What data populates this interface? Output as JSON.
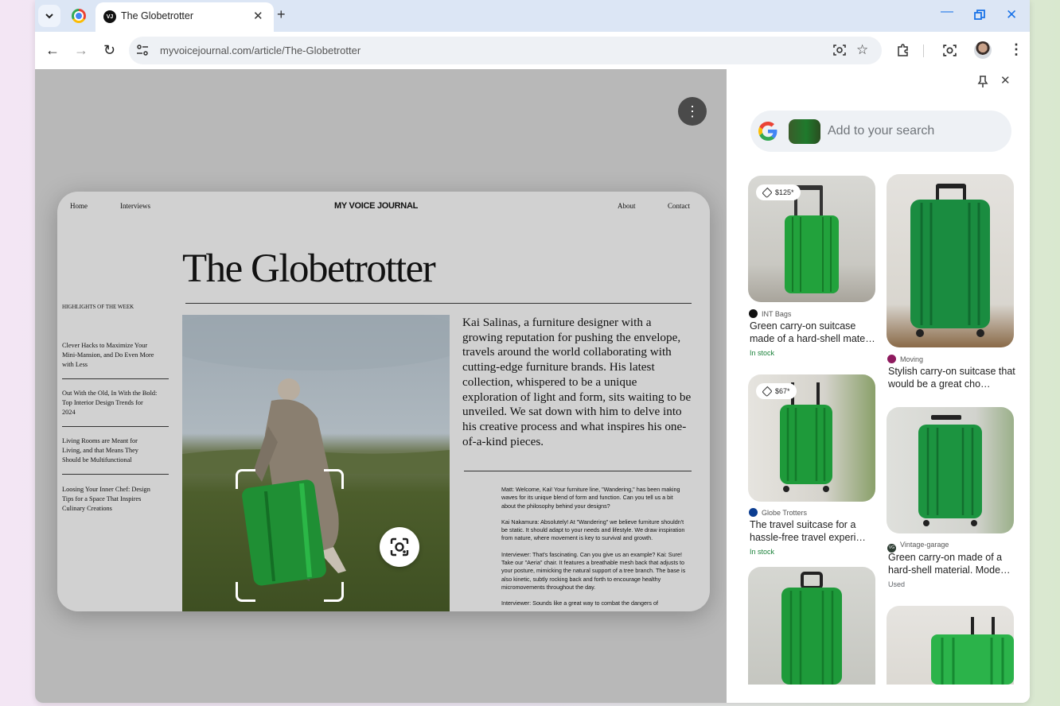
{
  "tab": {
    "title": "The Globetrotter",
    "favicon_text": "VJ"
  },
  "address_bar": {
    "url": "myvoicejournal.com/article/The-Globetrotter"
  },
  "page": {
    "nav_left": [
      "Home",
      "Interviews"
    ],
    "brand": "MY VOICE JOURNAL",
    "nav_right": [
      "About",
      "Contact"
    ],
    "headline": "The Globetrotter",
    "highlights_title": "HIGHLIGHTS OF THE WEEK",
    "highlights": [
      "Clever Hacks to Maximize Your Mini-Mansion, and Do Even More with Less",
      "Out With the Old, In With the Bold: Top Interior Design Trends for 2024",
      "Living Rooms are Meant for Living, and that Means They Should be Multifunctional",
      "Loosing Your Inner Chef: Design Tips for a Space That Inspires Culinary Creations"
    ],
    "lead": "Kai Salinas, a furniture designer with a growing reputation for pushing the envelope, travels around the world collaborating with cutting-edge furniture brands. His latest collection, whispered to be a unique exploration of light and form, sits waiting to be unveiled. We sat down with him to delve into his creative process and what inspires his one-of-a-kind pieces.",
    "interview": [
      "Matt: Welcome, Kai! Your furniture line, \"Wandering,\" has been making waves for its unique blend of form and function. Can you tell us a bit about the philosophy behind your designs?",
      "Kai Nakamura: Absolutely! At \"Wandering\" we believe furniture shouldn't be static. It should adapt to your needs and lifestyle. We draw inspiration from nature, where movement is key to survival and growth.",
      "Interviewer: That's fascinating. Can you give us an example? Kai: Sure! Take our \"Aeria\" chair. It features a breathable mesh back that adjusts to your posture, mimicking the natural support of a tree branch.  The base is also kinetic, subtly rocking back and forth to encourage healthy micromovements throughout the day.",
      "Interviewer: Sounds like a great way to combat the dangers of"
    ]
  },
  "lens_panel": {
    "search_placeholder": "Add to your search",
    "results": [
      {
        "price": "$125*",
        "source": "INT Bags",
        "source_badge": "INT",
        "title": "Green carry-on suitcase made of a hard-shell mate…",
        "status": "In stock"
      },
      {
        "price": "",
        "source": "Moving",
        "source_badge": "",
        "title": "Stylish carry-on suitcase that would be a great cho…",
        "status": ""
      },
      {
        "price": "$67*",
        "source": "Globe Trotters",
        "source_badge": "",
        "title": "The travel suitcase for a hassle-free travel experi…",
        "status": "In stock"
      },
      {
        "price": "",
        "source": "Vintage-garage",
        "source_badge": "VG",
        "title": "Green carry-on made of a hard-shell material. Mode…",
        "status": "Used"
      }
    ]
  },
  "colors": {
    "accent": "#1a73e8",
    "in_stock": "#188038",
    "suitcase_green": "#1e9a3a"
  }
}
